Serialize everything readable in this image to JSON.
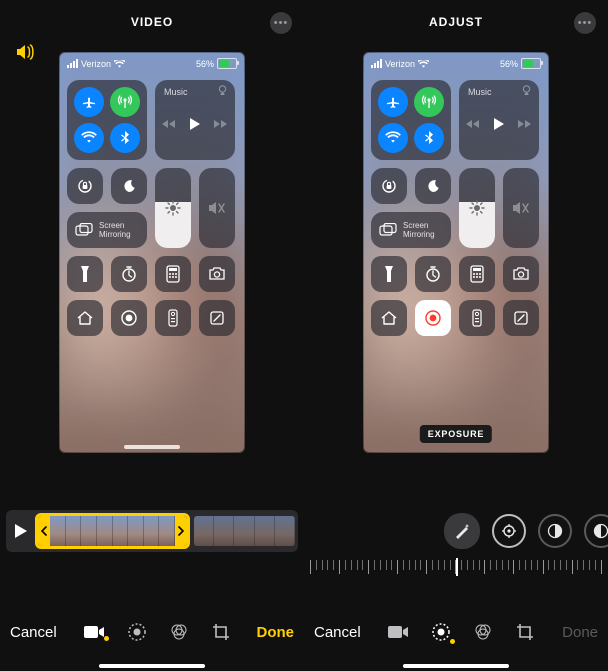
{
  "left": {
    "header": {
      "title": "VIDEO"
    },
    "status": {
      "carrier": "Verizon",
      "battery_pct": "56%"
    },
    "media_label": "Music",
    "mirror_label": "Screen\nMirroring",
    "bottom": {
      "cancel": "Cancel",
      "done": "Done"
    }
  },
  "right": {
    "header": {
      "title": "ADJUST"
    },
    "status": {
      "carrier": "Verizon",
      "battery_pct": "56%"
    },
    "media_label": "Music",
    "mirror_label": "Screen\nMirroring",
    "exposure_badge": "EXPOSURE",
    "bottom": {
      "cancel": "Cancel",
      "done": "Done"
    }
  },
  "icons": {
    "volume": "volume-icon",
    "more": "more-icon",
    "airplane": "airplane-icon",
    "cellular": "cellular-antenna-icon",
    "wifi": "wifi-icon",
    "bluetooth": "bluetooth-icon",
    "airplay": "airplay-icon",
    "rewind": "rewind-icon",
    "play": "play-icon",
    "forward": "forward-icon",
    "lock": "rotation-lock-icon",
    "moon": "do-not-disturb-icon",
    "mirror": "screen-mirroring-icon",
    "brightness": "brightness-icon",
    "mute": "mute-icon",
    "flashlight": "flashlight-icon",
    "timer": "timer-icon",
    "calculator": "calculator-icon",
    "camera": "camera-icon",
    "home": "home-icon",
    "record": "screen-record-icon",
    "remote": "remote-icon",
    "note": "quick-note-icon",
    "magic": "auto-enhance-icon",
    "exposure": "exposure-dial-icon",
    "highlights": "highlights-dial-icon",
    "shadows": "shadows-dial-icon",
    "video_tab": "video-tab-icon",
    "adjust_tab": "adjust-tab-icon",
    "filters_tab": "filters-tab-icon",
    "crop_tab": "crop-tab-icon"
  },
  "colors": {
    "accent": "#ffcf00",
    "green": "#34c759",
    "blue": "#0a84ff"
  }
}
